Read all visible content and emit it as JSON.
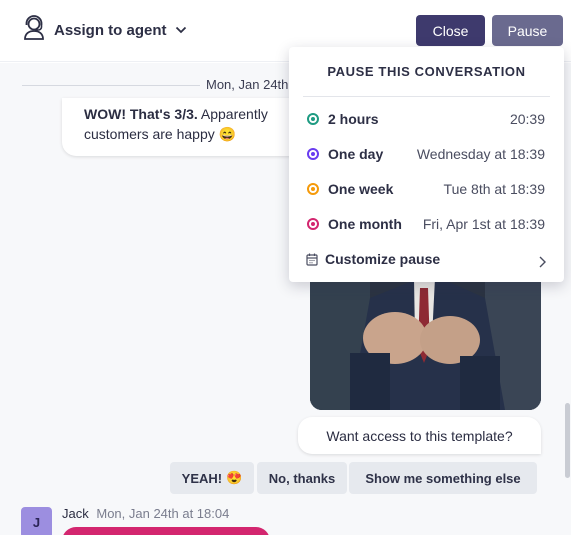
{
  "header": {
    "assign_label": "Assign to agent",
    "close_label": "Close",
    "pause_label": "Pause"
  },
  "chat": {
    "date_separator": "Mon, Jan 24th",
    "bot_message": {
      "bold": "WOW! That's 3/3.",
      "text": " Apparently",
      "line2": "customers are happy",
      "emoji": "😄"
    },
    "template_question": "Want access to this template?",
    "quick_replies": [
      {
        "label": "YEAH!",
        "emoji": "😍"
      },
      {
        "label": "No, thanks"
      },
      {
        "label": "Show me something else"
      }
    ],
    "sender": {
      "initial": "J",
      "name": "Jack",
      "time": "Mon, Jan 24th at 18:04"
    }
  },
  "pause_menu": {
    "title": "PAUSE THIS CONVERSATION",
    "options": [
      {
        "name": "2 hours",
        "when": "20:39",
        "color": "#1e9b82"
      },
      {
        "name": "One day",
        "when": "Wednesday at 18:39",
        "color": "#6a3cf0"
      },
      {
        "name": "One week",
        "when": "Tue 8th at 18:39",
        "color": "#f59a0a"
      },
      {
        "name": "One month",
        "when": "Fri, Apr 1st at 18:39",
        "color": "#d3266f"
      }
    ],
    "customize_label": "Customize pause"
  },
  "icons": {
    "assign": "agent-headset-icon",
    "assign_chevron": "chevron-down-icon",
    "customize": "calendar-icon",
    "customize_chevron": "chevron-right-icon"
  }
}
